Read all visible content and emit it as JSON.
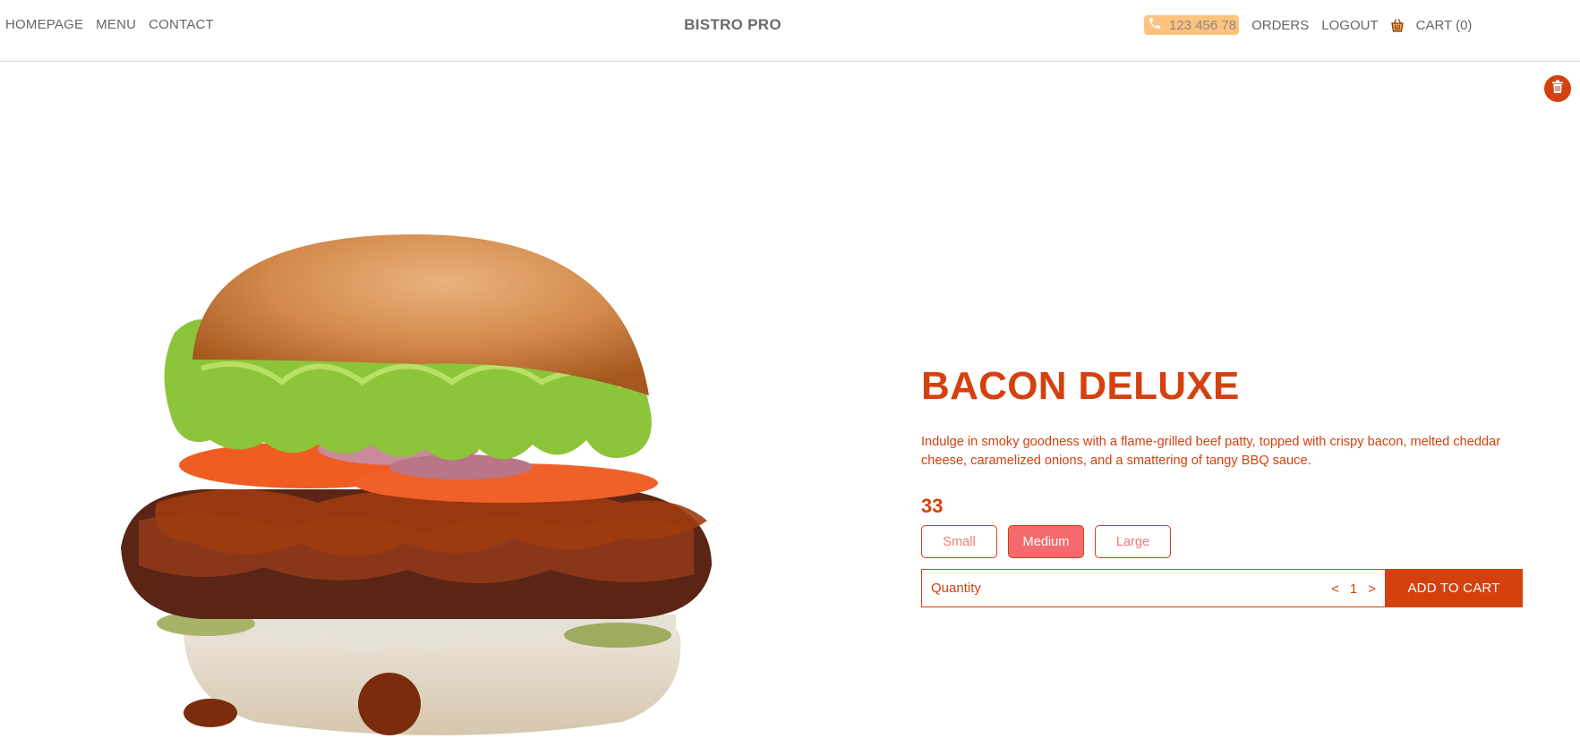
{
  "nav": {
    "links": [
      "HOMEPAGE",
      "MENU",
      "CONTACT"
    ],
    "brand": "BISTRO PRO",
    "phone": "123 456 78",
    "orders": "ORDERS",
    "logout": "LOGOUT",
    "cart": "CART (0)"
  },
  "product": {
    "name": "BACON DELUXE",
    "description": "Indulge in smoky goodness with a flame-grilled beef patty, topped with crispy bacon, melted cheddar cheese, caramelized onions, and a smattering of tangy BBQ sauce.",
    "price": "33",
    "sizes": [
      "Small",
      "Medium",
      "Large"
    ],
    "selected_size": "Medium",
    "quantity_label": "Quantity",
    "quantity": "1",
    "decrement": "<",
    "increment": ">",
    "add_to_cart": "ADD TO CART"
  },
  "colors": {
    "accent": "#d4410f",
    "phone_bg": "#fdc27d",
    "selected_size_bg": "#f46a6e"
  },
  "icons": [
    "phone-icon",
    "cart-icon",
    "trash-icon"
  ]
}
